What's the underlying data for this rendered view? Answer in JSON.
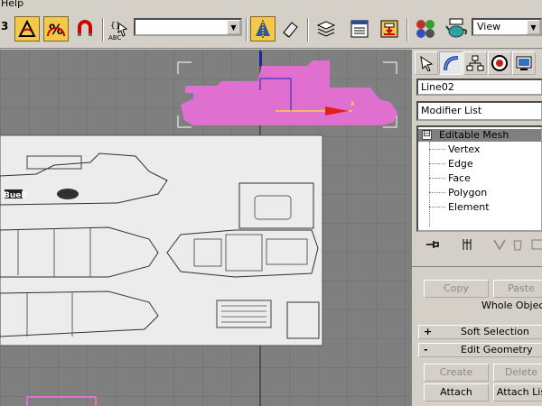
{
  "menu": {
    "help_label": "Help"
  },
  "toolbar": {
    "frag_label": "3",
    "abc_label": "ABC",
    "named_selection": "",
    "view_select": "View"
  },
  "viewport": {
    "background_color": "#7f7f7f",
    "grid_color": "#6e6e6e",
    "object_color": "#e070d0",
    "blueprint_texts": [
      "Buell"
    ]
  },
  "panel": {
    "object_name": "Line02",
    "modifier_list": "Modifier List",
    "stack": {
      "root": "Editable Mesh",
      "root_toggle": "⊟",
      "items": [
        "Vertex",
        "Edge",
        "Face",
        "Polygon",
        "Element"
      ]
    },
    "selection": {
      "copy": "Copy",
      "paste": "Paste",
      "whole_object": "Whole Object Selec"
    },
    "soft_selection": {
      "sign": "+",
      "title": "Soft Selection"
    },
    "edit_geometry": {
      "sign": "-",
      "title": "Edit Geometry"
    },
    "buttons": {
      "create": "Create",
      "delete": "Delete",
      "attach": "Attach",
      "attach_list": "Attach Lis"
    }
  }
}
